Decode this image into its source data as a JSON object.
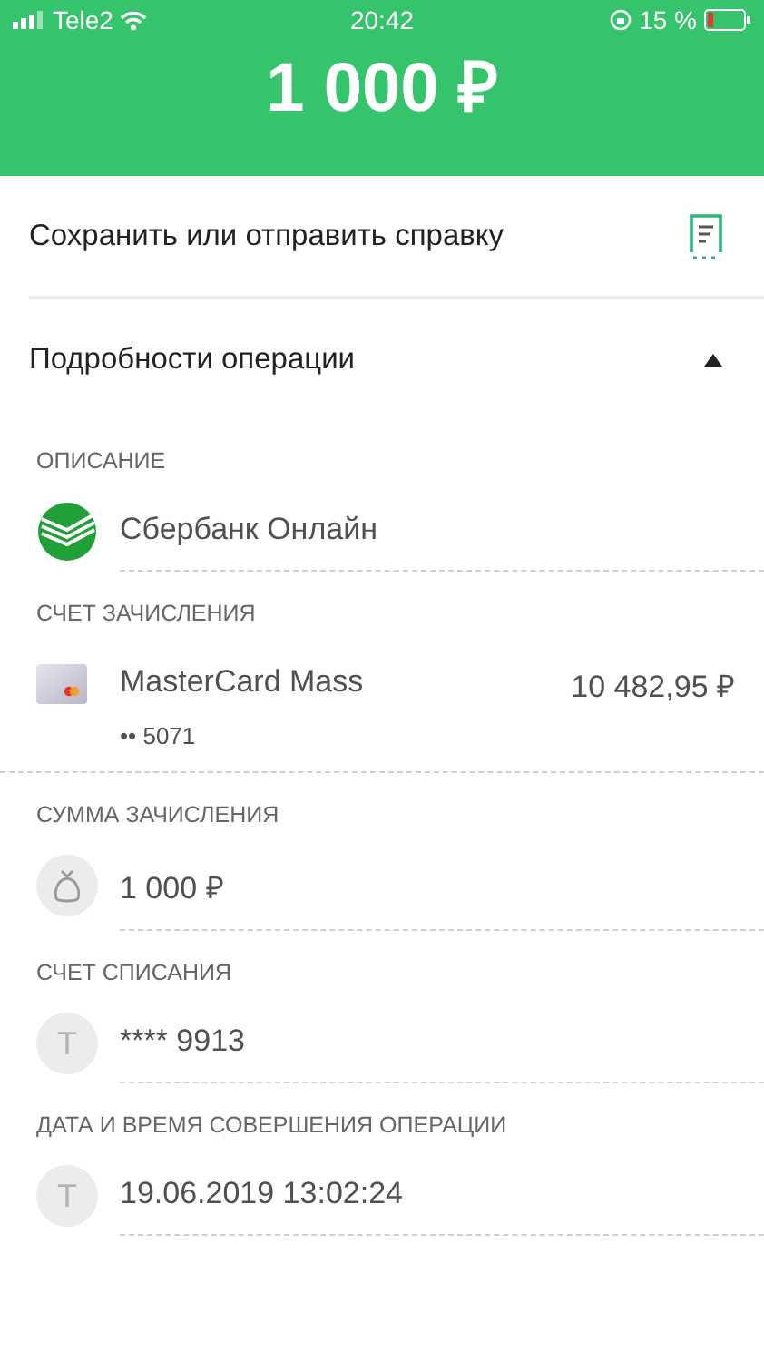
{
  "status_bar": {
    "carrier": "Tele2",
    "time": "20:42",
    "battery_percent": "15 %"
  },
  "header": {
    "amount": "1 000 ₽"
  },
  "actions": [
    {
      "label": "Сохранить или отправить справку",
      "kind": "receipt"
    }
  ],
  "details": {
    "title": "Подробности операции",
    "expanded": true,
    "sections": [
      {
        "label": "ОПИСАНИЕ",
        "kind": "sber",
        "title": "Сбербанк Онлайн"
      },
      {
        "label": "СЧЕТ ЗАЧИСЛЕНИЯ",
        "kind": "card",
        "title": "MasterCard Mass",
        "amount": "10 482,95 ₽",
        "subtitle": "•• 5071"
      },
      {
        "label": "СУММА ЗАЧИСЛЕНИЯ",
        "kind": "bag",
        "title": "1 000 ₽"
      },
      {
        "label": "СЧЕТ СПИСАНИЯ",
        "kind": "letter",
        "avatar_letter": "Т",
        "title": "**** 9913"
      },
      {
        "label": "ДАТА И ВРЕМЯ СОВЕРШЕНИЯ ОПЕРАЦИИ",
        "kind": "letter",
        "avatar_letter": "Т",
        "title": "19.06.2019 13:02:24"
      }
    ]
  }
}
